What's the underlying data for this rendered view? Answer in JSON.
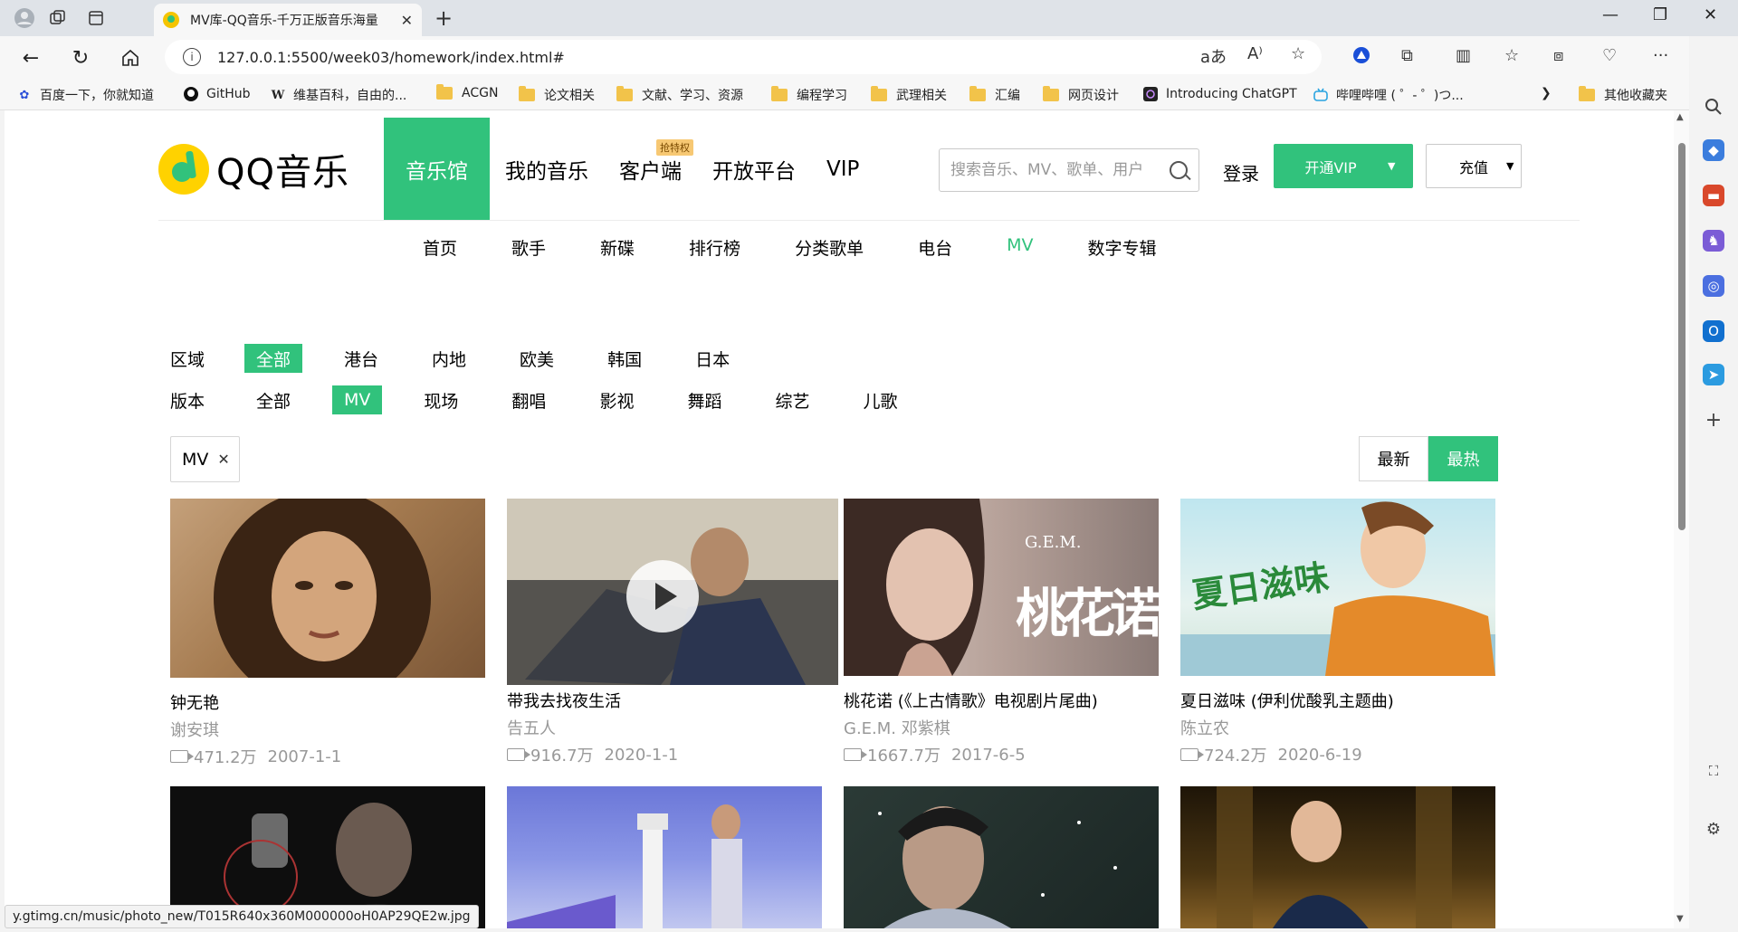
{
  "browser": {
    "tab_title": "MV库-QQ音乐-千万正版音乐海量",
    "url": "127.0.0.1:5500/week03/homework/index.html#",
    "bookmarks": [
      {
        "label": "百度一下，你就知道",
        "icon": "baidu-icon"
      },
      {
        "label": "GitHub",
        "icon": "github-icon"
      },
      {
        "label": "维基百科，自由的...",
        "icon": "wikipedia-icon"
      },
      {
        "label": "ACGN",
        "icon": "folder-icon"
      },
      {
        "label": "论文相关",
        "icon": "folder-icon"
      },
      {
        "label": "文献、学习、资源",
        "icon": "folder-icon"
      },
      {
        "label": "编程学习",
        "icon": "folder-icon"
      },
      {
        "label": "武理相关",
        "icon": "folder-icon"
      },
      {
        "label": "汇编",
        "icon": "folder-icon"
      },
      {
        "label": "网页设计",
        "icon": "folder-icon"
      },
      {
        "label": "Introducing ChatGPT",
        "icon": "openai-icon"
      },
      {
        "label": "哔哩哔哩 ( ゜- ゜)つ...",
        "icon": "bilibili-icon"
      }
    ],
    "other_bookmarks": "其他收藏夹",
    "status_url": "y.gtimg.cn/music/photo_new/T015R640x360M000000oH0AP29QE2w.jpg"
  },
  "site": {
    "logo_text": "QQ音乐",
    "accent_color": "#31c27c",
    "top_nav": [
      {
        "label": "音乐馆",
        "active": true
      },
      {
        "label": "我的音乐",
        "active": false
      },
      {
        "label": "客户端",
        "active": false,
        "badge": "抢特权"
      },
      {
        "label": "开放平台",
        "active": false
      },
      {
        "label": "VIP",
        "active": false
      }
    ],
    "search_placeholder": "搜索音乐、MV、歌单、用户",
    "login": "登录",
    "vip_button": "开通VIP",
    "charge_button": "充值",
    "sub_nav": [
      {
        "label": "首页",
        "active": false
      },
      {
        "label": "歌手",
        "active": false
      },
      {
        "label": "新碟",
        "active": false
      },
      {
        "label": "排行榜",
        "active": false
      },
      {
        "label": "分类歌单",
        "active": false
      },
      {
        "label": "电台",
        "active": false
      },
      {
        "label": "MV",
        "active": true
      },
      {
        "label": "数字专辑",
        "active": false
      }
    ]
  },
  "filters": {
    "region_label": "区域",
    "regions": [
      {
        "label": "全部",
        "active": true
      },
      {
        "label": "港台",
        "active": false
      },
      {
        "label": "内地",
        "active": false
      },
      {
        "label": "欧美",
        "active": false
      },
      {
        "label": "韩国",
        "active": false
      },
      {
        "label": "日本",
        "active": false
      }
    ],
    "version_label": "版本",
    "versions": [
      {
        "label": "全部",
        "active": false
      },
      {
        "label": "MV",
        "active": true
      },
      {
        "label": "现场",
        "active": false
      },
      {
        "label": "翻唱",
        "active": false
      },
      {
        "label": "影视",
        "active": false
      },
      {
        "label": "舞蹈",
        "active": false
      },
      {
        "label": "综艺",
        "active": false
      },
      {
        "label": "儿歌",
        "active": false
      }
    ],
    "selected_tag": "MV",
    "sort": [
      {
        "label": "最新",
        "active": false
      },
      {
        "label": "最热",
        "active": true
      }
    ]
  },
  "mv_list": [
    {
      "title": "钟无艳",
      "artist": "谢安琪",
      "plays": "471.2万",
      "date": "2007-1-1"
    },
    {
      "title": "带我去找夜生活",
      "artist": "告五人",
      "plays": "916.7万",
      "date": "2020-1-1"
    },
    {
      "title": "桃花诺 (《上古情歌》电视剧片尾曲)",
      "artist": "G.E.M. 邓紫棋",
      "plays": "1667.7万",
      "date": "2017-6-5",
      "cover_text": "桃花诺"
    },
    {
      "title": "夏日滋味 (伊利优酸乳主题曲)",
      "artist": "陈立农",
      "plays": "724.2万",
      "date": "2020-6-19",
      "cover_text": "夏日滋味"
    }
  ]
}
